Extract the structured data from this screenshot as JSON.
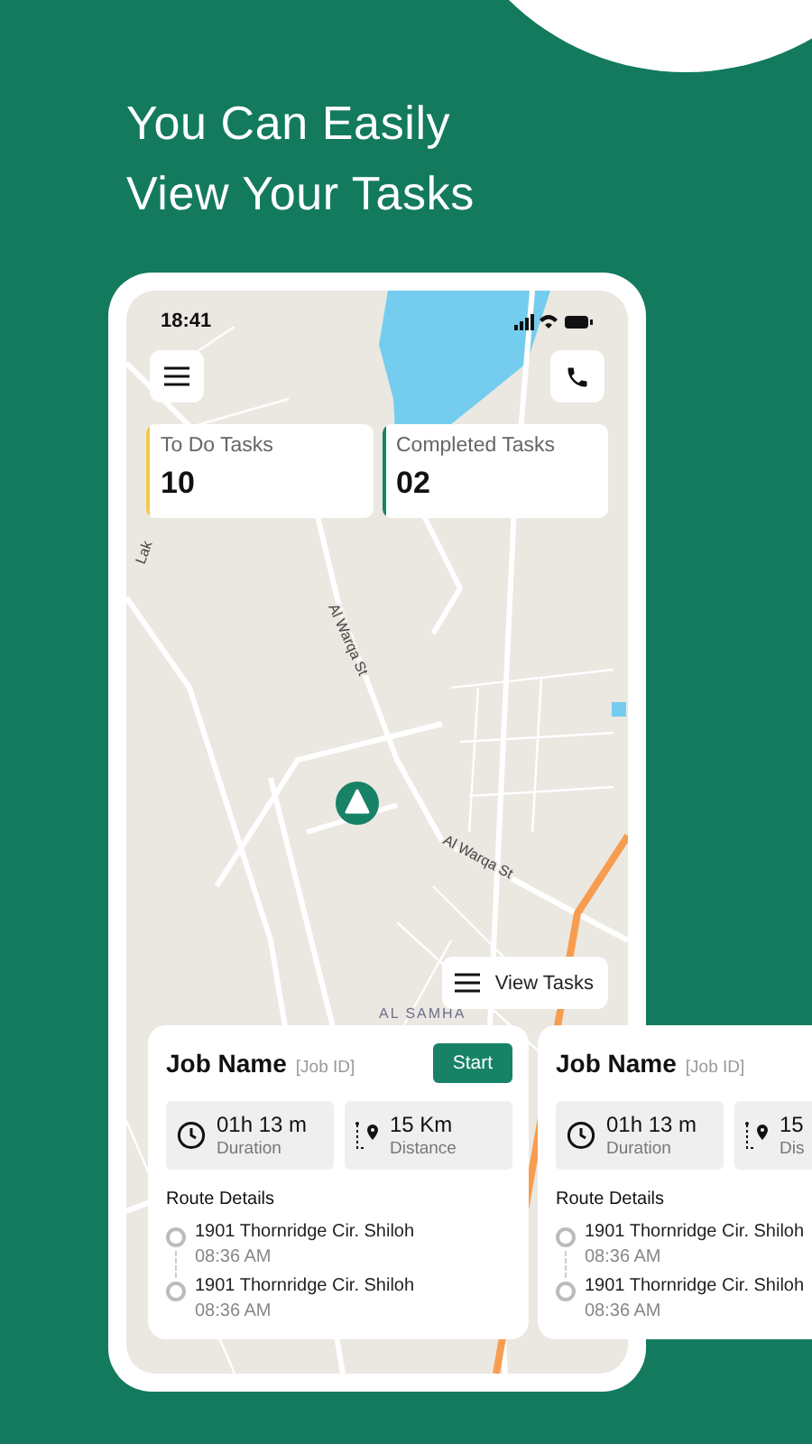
{
  "headline": [
    "You Can Easily",
    "View Your Tasks"
  ],
  "status_bar": {
    "time": "18:41"
  },
  "map": {
    "labels": [
      "Al Warqa St",
      "Al Warqa St",
      "AL SAMHA",
      "Lak"
    ]
  },
  "stats": [
    {
      "label": "To Do Tasks",
      "value": "10",
      "color": "#f2c94c"
    },
    {
      "label": "Completed Tasks",
      "value": "02",
      "color": "#178266"
    }
  ],
  "view_tasks_button": "View Tasks",
  "job_cards": [
    {
      "title": "Job Name",
      "job_id": "[Job ID]",
      "start_button": "Start",
      "duration_value": "01h 13 m",
      "duration_label": "Duration",
      "distance_value": "15 Km",
      "distance_label": "Distance",
      "route_title": "Route Details",
      "stops": [
        {
          "address": "1901 Thornridge Cir. Shiloh",
          "time": "08:36 AM"
        },
        {
          "address": "1901 Thornridge Cir. Shiloh",
          "time": "08:36 AM"
        }
      ]
    },
    {
      "title": "Job Name",
      "job_id": "[Job ID]",
      "duration_value": "01h 13 m",
      "duration_label": "Duration",
      "distance_value": "15",
      "distance_label": "Dis",
      "route_title": "Route Details",
      "stops": [
        {
          "address": "1901 Thornridge Cir. Shiloh",
          "time": "08:36 AM"
        },
        {
          "address": "1901 Thornridge Cir. Shiloh",
          "time": "08:36 AM"
        }
      ]
    }
  ]
}
